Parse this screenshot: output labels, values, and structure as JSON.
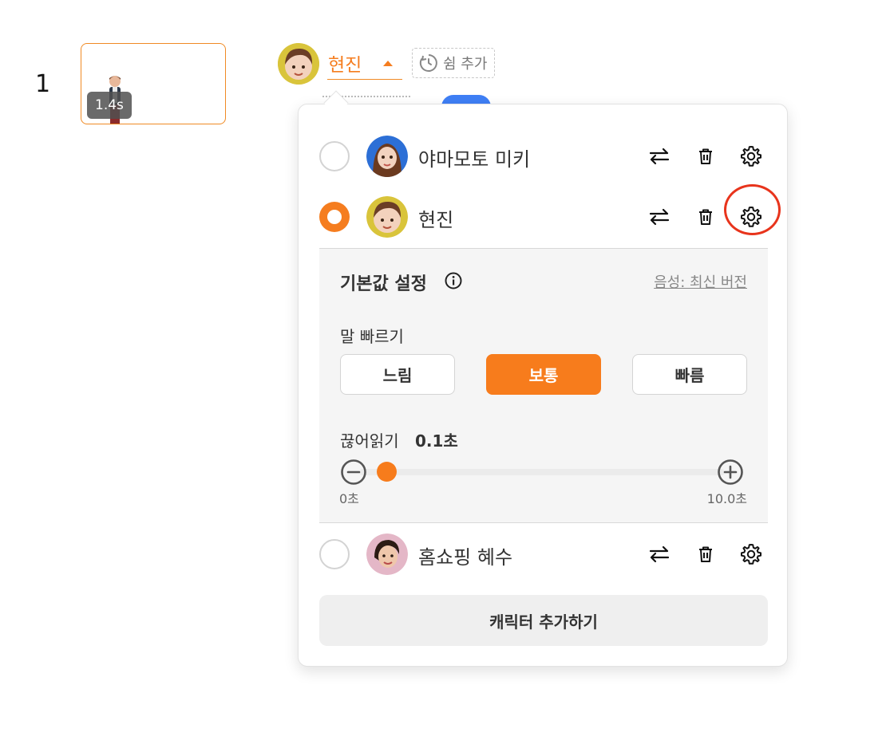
{
  "scene": {
    "index": "1",
    "duration": "1.4s"
  },
  "header": {
    "character_name": "현진",
    "pause_button_label": "쉼 추가"
  },
  "accent_color": "#f57d1f",
  "characters": [
    {
      "name": "야마모토 미키",
      "selected": false
    },
    {
      "name": "현진",
      "selected": true
    },
    {
      "name": "홈쇼핑 혜수",
      "selected": false
    }
  ],
  "settings": {
    "title": "기본값 설정",
    "voice_link": "음성: 최신 버전",
    "speed_label": "말 빠르기",
    "speed_options": [
      "느림",
      "보통",
      "빠름"
    ],
    "speed_selected": "보통",
    "pause_label": "끊어읽기",
    "pause_value": "0.1초",
    "pause_fraction": 0.01,
    "range_min": "0초",
    "range_max": "10.0초"
  },
  "add_character_label": "캐릭터 추가하기",
  "icons": {
    "swap": "swap-arrows-icon",
    "delete": "trash-icon",
    "settings": "gear-icon",
    "info": "info-icon",
    "pause": "timer-icon"
  }
}
